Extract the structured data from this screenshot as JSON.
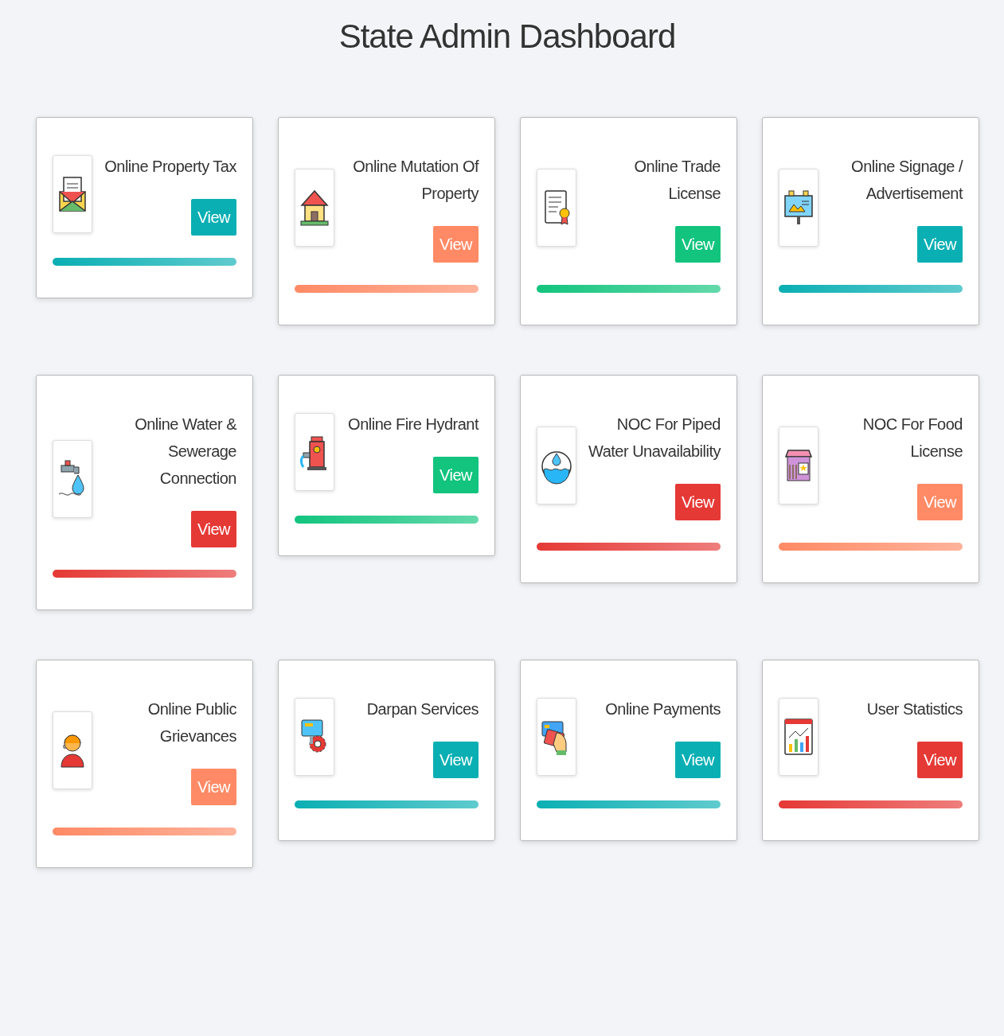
{
  "title": "State Admin Dashboard",
  "cards": [
    {
      "title": "Online Property Tax",
      "button": "View",
      "color": "#0aafb3"
    },
    {
      "title": "Online Mutation Of Property",
      "button": "View",
      "color": "#ff8a65"
    },
    {
      "title": "Online Trade License",
      "button": "View",
      "color": "#12c47e"
    },
    {
      "title": "Online Signage / Advertisement",
      "button": "View",
      "color": "#0aafb3"
    },
    {
      "title": "Online Water & Sewerage Connection",
      "button": "View",
      "color": "#e53935"
    },
    {
      "title": "Online Fire Hydrant",
      "button": "View",
      "color": "#12c47e"
    },
    {
      "title": "NOC For Piped Water Unavailability",
      "button": "View",
      "color": "#e53935"
    },
    {
      "title": "NOC For Food License",
      "button": "View",
      "color": "#ff8a65"
    },
    {
      "title": "Online Public Grievances",
      "button": "View",
      "color": "#ff8a65"
    },
    {
      "title": "Darpan Services",
      "button": "View",
      "color": "#0aafb3"
    },
    {
      "title": "Online Payments",
      "button": "View",
      "color": "#0aafb3"
    },
    {
      "title": "User Statistics",
      "button": "View",
      "color": "#e53935"
    }
  ]
}
